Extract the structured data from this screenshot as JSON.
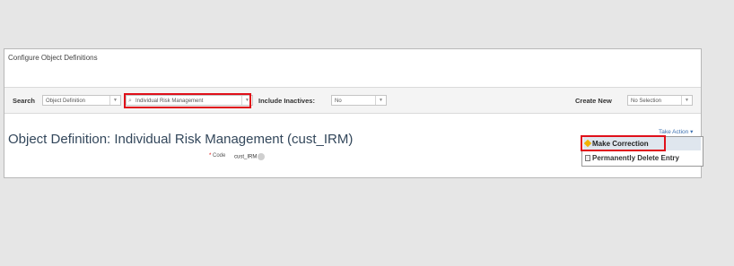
{
  "panel": {
    "title": "Configure Object Definitions"
  },
  "search": {
    "label": "Search",
    "type_select": "Object Definition",
    "query_select": "Individual Risk Management",
    "include_inactives_label": "Include Inactives:",
    "include_inactives_value": "No",
    "create_new_label": "Create New",
    "create_new_value": "No Selection"
  },
  "object": {
    "title": "Object Definition: Individual Risk Management (cust_IRM)",
    "code_label": "Code",
    "code_required_marker": "*",
    "code_value": "cust_IRM"
  },
  "take_action": {
    "label": "Take Action",
    "items": [
      {
        "label": "Make Correction",
        "icon": "pencil-icon"
      },
      {
        "label": "Permanently Delete Entry",
        "icon": "trash-icon"
      }
    ]
  },
  "colors": {
    "highlight": "#e0101a",
    "title": "#33475b",
    "link": "#3a6fb0"
  }
}
